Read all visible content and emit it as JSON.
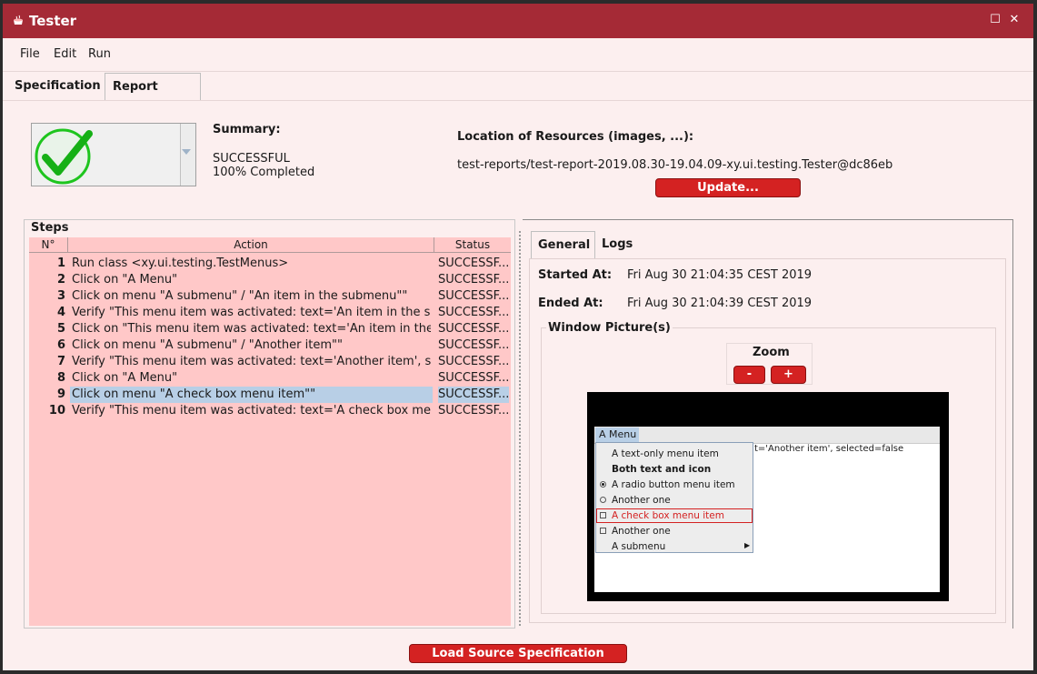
{
  "window": {
    "title": "Tester",
    "maximize_glyph": "☐",
    "close_glyph": "✕"
  },
  "menu": [
    "File",
    "Edit",
    "Run"
  ],
  "tabs": [
    "Specification",
    "Report"
  ],
  "summary": {
    "label": "Summary:",
    "result": "SUCCESSFUL",
    "completion": "100% Completed"
  },
  "resources": {
    "label": "Location of Resources (images, ...):",
    "path": "test-reports/test-report-2019.08.30-19.04.09-xy.ui.testing.Tester@dc86eb",
    "update_label": "Update..."
  },
  "steps": {
    "title": "Steps",
    "columns": [
      "N°",
      "Action",
      "Status"
    ],
    "selected_index": 8,
    "rows": [
      {
        "n": "1",
        "action": "Run class <xy.ui.testing.TestMenus>",
        "status": "SUCCESSF..."
      },
      {
        "n": "2",
        "action": "Click on \"A Menu\"",
        "status": "SUCCESSF..."
      },
      {
        "n": "3",
        "action": "Click on menu \"A submenu\" / \"An item in the submenu\"\"",
        "status": "SUCCESSF..."
      },
      {
        "n": "4",
        "action": "Verify \"This menu item was activated: text='An item in the su...",
        "status": "SUCCESSF..."
      },
      {
        "n": "5",
        "action": "Click on \"This menu item was activated: text='An item in the ...",
        "status": "SUCCESSF..."
      },
      {
        "n": "6",
        "action": "Click on menu \"A submenu\" / \"Another item\"\"",
        "status": "SUCCESSF..."
      },
      {
        "n": "7",
        "action": "Verify \"This menu item was activated: text='Another item', sel...",
        "status": "SUCCESSF..."
      },
      {
        "n": "8",
        "action": "Click on \"A Menu\"",
        "status": "SUCCESSF..."
      },
      {
        "n": "9",
        "action": "Click on menu \"A check box menu item\"\"",
        "status": "SUCCESSF..."
      },
      {
        "n": "10",
        "action": "Verify \"This menu item was activated: text='A check box men...",
        "status": "SUCCESSF..."
      }
    ]
  },
  "details": {
    "tabs": [
      "General",
      "Logs"
    ],
    "started_label": "Started At:",
    "started_value": "Fri Aug 30 21:04:35 CEST 2019",
    "ended_label": "Ended At:",
    "ended_value": "Fri Aug 30 21:04:39 CEST 2019",
    "window_pictures_label": "Window Picture(s)",
    "zoom_label": "Zoom",
    "zoom_out": "-",
    "zoom_in": "+"
  },
  "screenshot": {
    "menu_title": "A Menu",
    "background_text": "t='Another item', selected=false",
    "items": [
      {
        "label": "A text-only menu item",
        "marker": "none"
      },
      {
        "label": "Both text and icon",
        "marker": "none"
      },
      {
        "label": "A radio button menu item",
        "marker": "radio-on"
      },
      {
        "label": "Another one",
        "marker": "radio-off"
      },
      {
        "label": "A check box menu item",
        "marker": "check"
      },
      {
        "label": "Another one",
        "marker": "check"
      },
      {
        "label": "A submenu",
        "marker": "none"
      }
    ],
    "highlighted_index": 4,
    "highlight_color": "#d42222",
    "submenu_arrow": "▶"
  },
  "footer": {
    "load_label": "Load Source Specification"
  },
  "colors": {
    "titlebar": "#a52a36",
    "button": "#d42222",
    "table_bg": "#ffc8c8",
    "selection": "#b8cfe6",
    "success": "#1ec51e"
  }
}
